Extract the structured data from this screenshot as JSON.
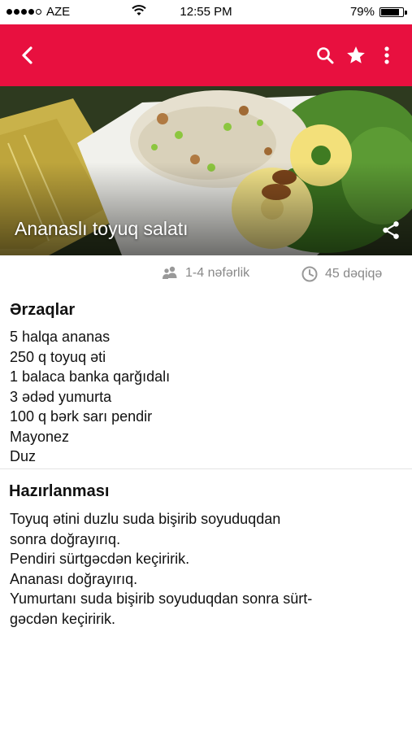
{
  "status_bar": {
    "carrier": "AZE",
    "time": "12:55 PM",
    "battery": "79%",
    "battery_level": 0.79
  },
  "app_bar": {
    "color": "#e8103f",
    "icons": [
      "back-arrow-icon",
      "search-icon",
      "star-icon",
      "more-vert-icon"
    ]
  },
  "recipe": {
    "title": "Ananaslı toyuq salatı",
    "servings": "1-4 nəfərlik",
    "duration": "45 dəqiqə"
  },
  "ingredients": {
    "heading": "Ərzaqlar",
    "items": [
      "5 halqa ananas",
      "250 q toyuq əti",
      "1 balaca banka qarğıdalı",
      "3 ədəd yumurta",
      "100 q bərk sarı pendir",
      "Mayonez",
      "Duz"
    ]
  },
  "preparation": {
    "heading": "Hazırlanması",
    "lines": [
      "Toyuq ətini duzlu suda bişirib soyuduqdan",
      "sonra doğrayırıq.",
      "Pendiri sürtgəcdən keçiririk.",
      "Ananası doğrayırıq.",
      "Yumurtanı suda bişirib soyuduqdan sonra sürt-",
      "gəcdən keçiririk."
    ]
  }
}
